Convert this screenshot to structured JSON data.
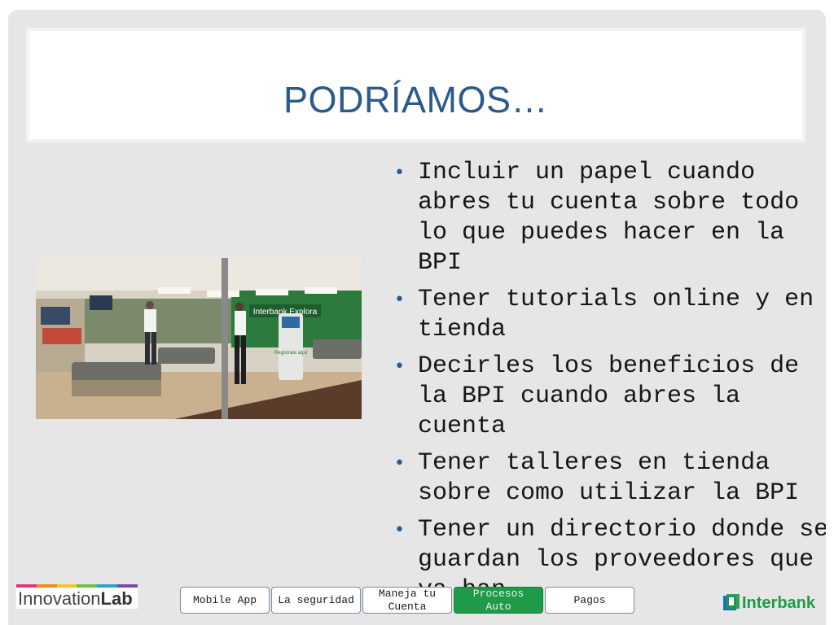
{
  "slide": {
    "title": "PODRÍAMOS…",
    "bullets": [
      "Incluir un papel cuando abres tu cuenta sobre todo lo que puedes hacer en la BPI",
      "Tener tutorials online y en tienda",
      "Decirles los beneficios de la BPI cuando abres la cuenta",
      "Tener talleres en tienda sobre como utilizar la BPI",
      "Tener un directorio donde se guardan los proveedores que ya han"
    ],
    "bullet_symbol": "•",
    "photo": {
      "sign_explora": "Interbank Explora",
      "sign_kiosk": "Registrate aqui"
    }
  },
  "footer": {
    "logo_left": {
      "part1": "Innovation",
      "part2": "Lab"
    },
    "nav": [
      {
        "label": "Mobile App",
        "active": false
      },
      {
        "label": "La seguridad",
        "active": false
      },
      {
        "label": "Maneja tu Cuenta",
        "active": false
      },
      {
        "label": "Procesos Auto",
        "active": true
      },
      {
        "label": "Pagos",
        "active": false
      }
    ],
    "brand_right": "Interbank"
  },
  "colors": {
    "title": "#2c5a8a",
    "accent_green": "#1f9a48",
    "slide_bg": "#e6e6e6"
  }
}
